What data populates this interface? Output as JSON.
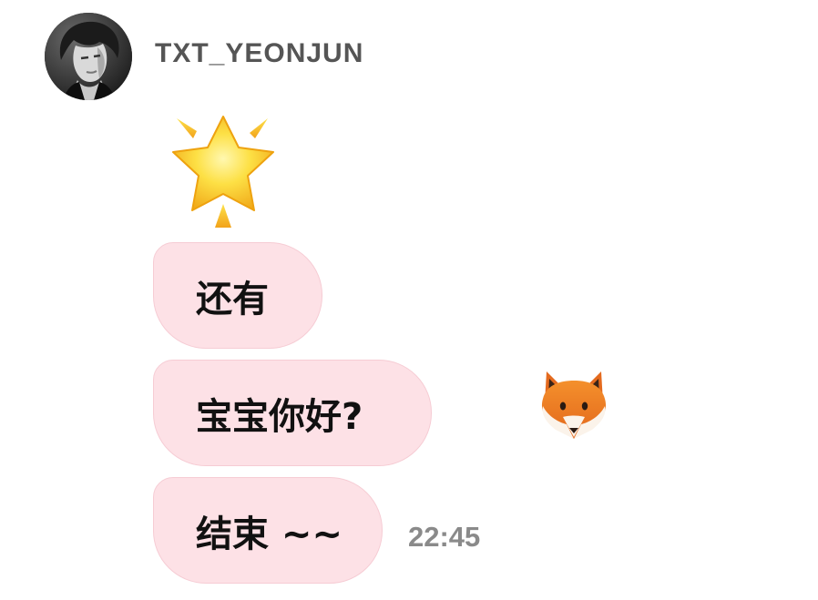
{
  "header": {
    "sender_name": "TXT_YEONJUN",
    "avatar_icon": "profile-photo"
  },
  "sticker": {
    "icon": "glowing-star-icon"
  },
  "messages": [
    {
      "text": "还有"
    },
    {
      "text": "宝宝你好?"
    },
    {
      "text": "结束 ~~"
    }
  ],
  "reaction": {
    "icon": "fox-face-icon"
  },
  "timestamp": "22:45",
  "colors": {
    "bubble_bg": "#fde1e6",
    "bubble_border": "#f6ccd4",
    "sender_text": "#555555",
    "timestamp_text": "#8a8a8a"
  }
}
